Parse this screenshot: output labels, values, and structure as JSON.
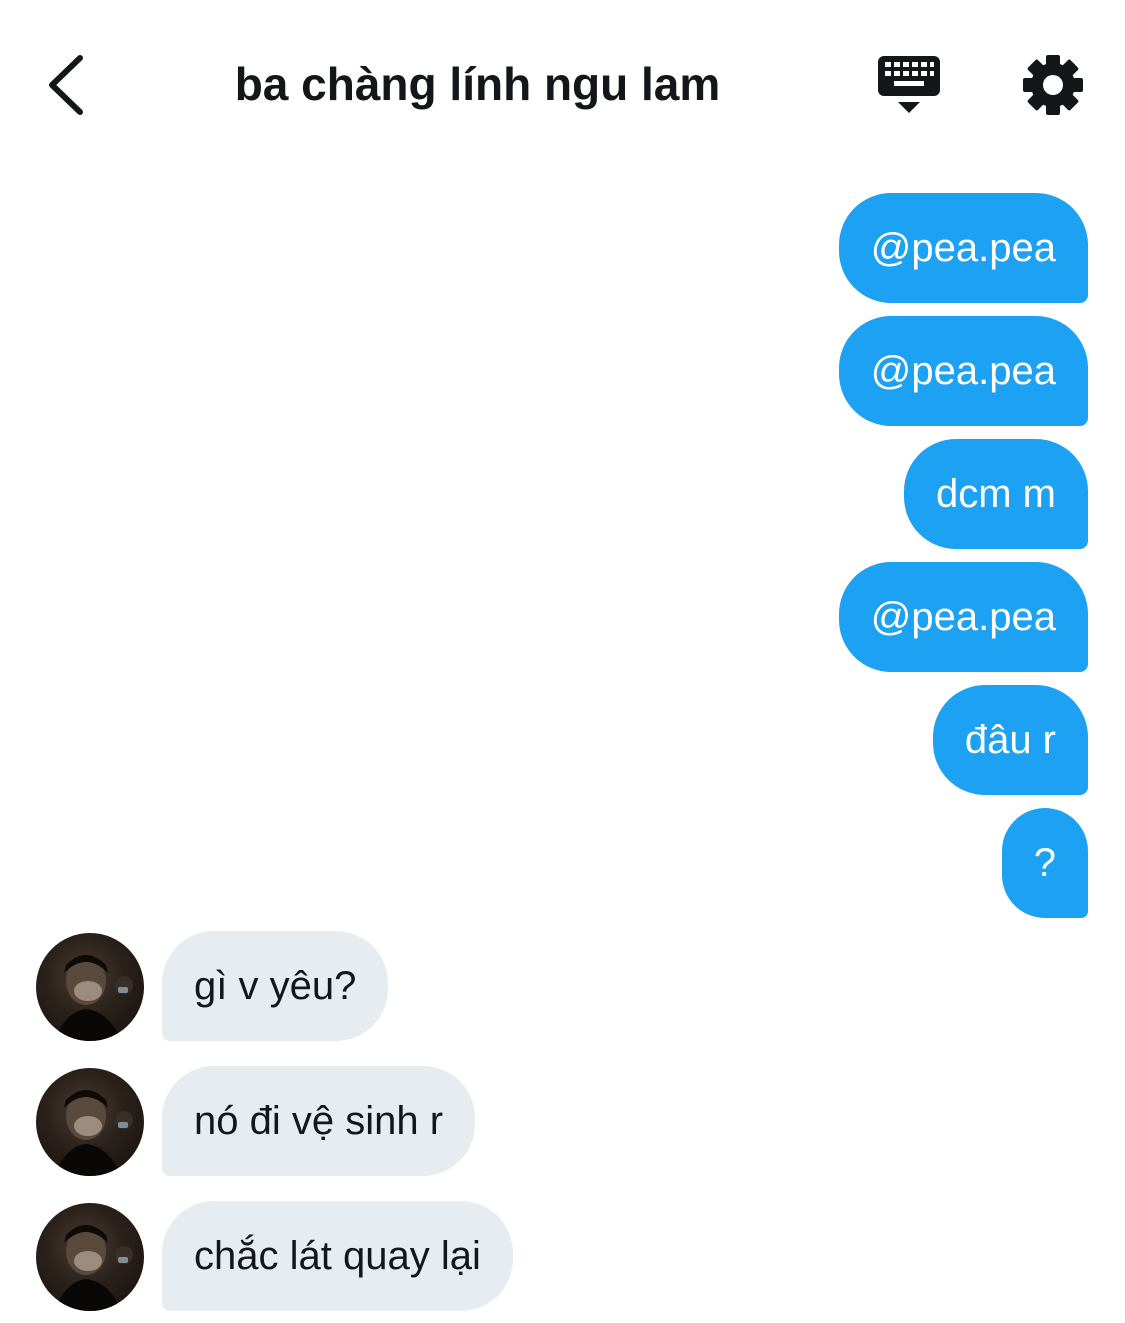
{
  "header": {
    "title": "ba chàng lính ngu lam",
    "back_icon": "chevron-left-icon",
    "keyboard_icon": "keyboard-icon",
    "settings_icon": "gear-icon"
  },
  "colors": {
    "outgoing_bubble": "#1da1f2",
    "incoming_bubble": "#e6ecf0",
    "title_text": "#14171a"
  },
  "messages": [
    {
      "direction": "outgoing",
      "text": "@pea.pea"
    },
    {
      "direction": "outgoing",
      "text": "@pea.pea"
    },
    {
      "direction": "outgoing",
      "text": "dcm m"
    },
    {
      "direction": "outgoing",
      "text": "@pea.pea"
    },
    {
      "direction": "outgoing",
      "text": "đâu r"
    },
    {
      "direction": "outgoing",
      "text": "?"
    },
    {
      "direction": "incoming",
      "text": "gì v yêu?"
    },
    {
      "direction": "incoming",
      "text": "nó đi vệ sinh r"
    },
    {
      "direction": "incoming",
      "text": "chắc lát quay lại"
    }
  ]
}
